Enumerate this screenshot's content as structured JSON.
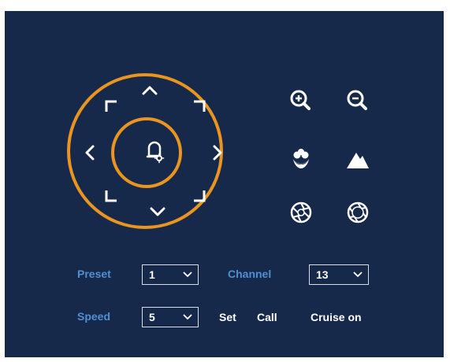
{
  "ptz": {
    "outer_ring_color": "#e9951f",
    "inner_ring_color": "#e9951f",
    "center_icon": "ptz-settings-icon",
    "directions": [
      "up",
      "down",
      "left",
      "right",
      "up-left",
      "up-right",
      "down-left",
      "down-right"
    ]
  },
  "controls": {
    "zoom_in_icon": "zoom-in-icon",
    "zoom_out_icon": "zoom-out-icon",
    "focus_near_icon": "focus-near-icon",
    "focus_far_icon": "focus-far-icon",
    "iris_open_icon": "iris-open-icon",
    "iris_close_icon": "iris-close-icon"
  },
  "form": {
    "preset_label": "Preset",
    "preset_value": "1",
    "channel_label": "Channel",
    "channel_value": "13",
    "speed_label": "Speed",
    "speed_value": "5",
    "set_label": "Set",
    "call_label": "Call",
    "cruise_label": "Cruise on"
  },
  "colors": {
    "background": "#17294a",
    "accent": "#e9951f",
    "label_blue": "#4f8fd4",
    "text": "#ffffff"
  }
}
